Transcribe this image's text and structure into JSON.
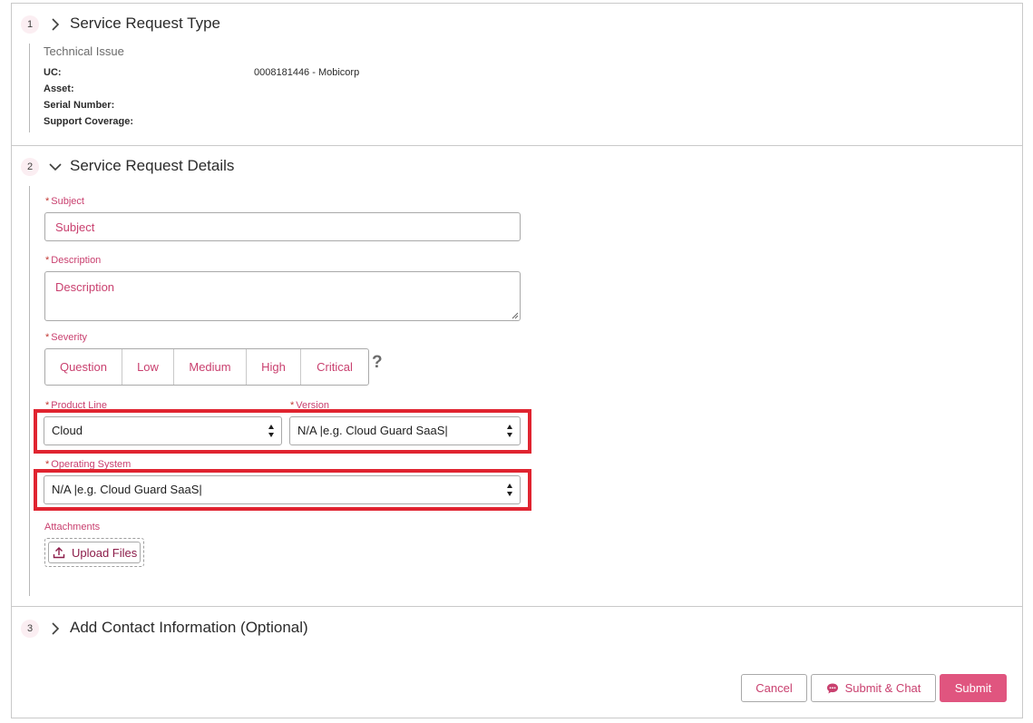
{
  "sections": {
    "type": {
      "number": "1",
      "title": "Service Request Type"
    },
    "details": {
      "number": "2",
      "title": "Service Request Details"
    },
    "contact": {
      "number": "3",
      "title": "Add Contact Information (Optional)"
    }
  },
  "request_type": {
    "title": "Technical Issue",
    "fields": [
      {
        "label": "UC:",
        "value": "0008181446 - Mobicorp"
      },
      {
        "label": "Asset:",
        "value": ""
      },
      {
        "label": "Serial Number:",
        "value": ""
      },
      {
        "label": "Support Coverage:",
        "value": ""
      }
    ]
  },
  "form": {
    "required_mark": "*",
    "subject": {
      "label": "Subject",
      "placeholder": "Subject"
    },
    "description": {
      "label": "Description",
      "placeholder": "Description"
    },
    "severity": {
      "label": "Severity",
      "options": [
        "Question",
        "Low",
        "Medium",
        "High",
        "Critical"
      ],
      "help": "?"
    },
    "product_line": {
      "label": "Product Line",
      "value": "Cloud"
    },
    "version": {
      "label": "Version",
      "value": "N/A |e.g. Cloud Guard SaaS|"
    },
    "operating_system": {
      "label": "Operating System",
      "value": "N/A |e.g. Cloud Guard SaaS|"
    },
    "attachments": {
      "label": "Attachments",
      "upload_label": "Upload Files"
    }
  },
  "actions": {
    "cancel": "Cancel",
    "submit_chat": "Submit & Chat",
    "submit": "Submit"
  },
  "icons": {
    "section_collapsed": "chevron-right-icon",
    "section_expanded": "chevron-down-icon",
    "upload": "upload-icon",
    "chat": "chat-bubble-icon",
    "select": "select-arrows-icon"
  },
  "colors": {
    "accent": "#c9406f",
    "primary_button": "#e0557f",
    "highlight": "#e02430",
    "required": "#c23934"
  }
}
